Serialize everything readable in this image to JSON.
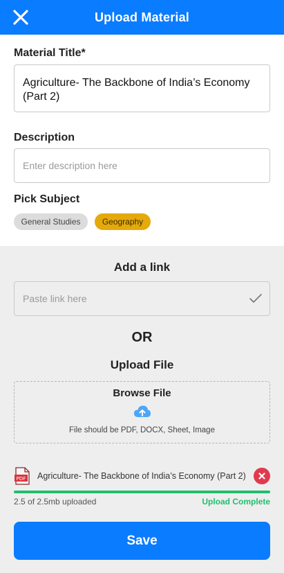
{
  "header": {
    "title": "Upload Material",
    "close_icon": "close-icon",
    "background_color": "#0a7cff"
  },
  "form": {
    "title_label": "Material Title*",
    "title_value": "Agriculture- The Backbone of India’s Economy (Part 2)",
    "description_label": "Description",
    "description_placeholder": "Enter description here",
    "subject_label": "Pick Subject",
    "subjects": [
      {
        "label": "General Studies",
        "selected": false,
        "color": "#dcdcdc"
      },
      {
        "label": "Geography",
        "selected": true,
        "color": "#e5a90b"
      }
    ]
  },
  "link_section": {
    "heading": "Add a link",
    "placeholder": "Paste link here",
    "confirm_icon": "check-icon"
  },
  "divider_text": "OR",
  "upload_section": {
    "heading": "Upload File",
    "browse_label": "Browse File",
    "upload_icon": "cloud-upload-icon",
    "hint": "File should be PDF, DOCX, Sheet, Image"
  },
  "uploaded_file": {
    "file_icon": "pdf-file-icon",
    "name": "Agriculture- The Backbone of India’s Economy (Part 2)",
    "progress_percent": 100,
    "size_text": "2.5 of 2.5mb uploaded",
    "status": "Upload Complete",
    "status_color": "#1fbf6e",
    "remove_icon": "remove-icon"
  },
  "save_label": "Save"
}
